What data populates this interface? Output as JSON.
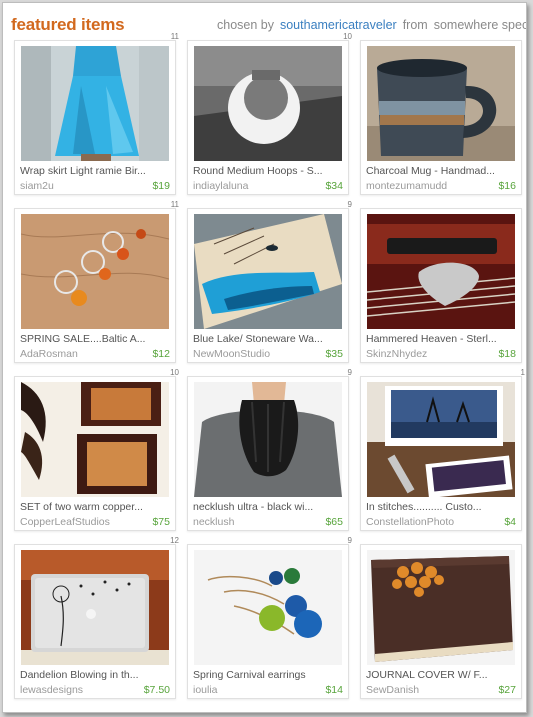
{
  "header": {
    "title": "featured items",
    "chosen_by": "chosen by",
    "curator": "southamericatraveler",
    "from_label": "from",
    "from_text": "somewhere specia"
  },
  "items": [
    {
      "title": "Wrap skirt Light ramie Bir...",
      "shop": "siam2u",
      "price": "$19",
      "count": "11",
      "image": "blue-wrap-skirt"
    },
    {
      "title": "Round Medium Hoops - S...",
      "shop": "indiaylaluna",
      "price": "$34",
      "count": "10",
      "image": "silver-hoop"
    },
    {
      "title": "Charcoal Mug - Handmad...",
      "shop": "montezumamudd",
      "price": "$16",
      "count": "",
      "image": "charcoal-mug"
    },
    {
      "title": "SPRING SALE....Baltic A...",
      "shop": "AdaRosman",
      "price": "$12",
      "count": "11",
      "image": "amber-rings"
    },
    {
      "title": "Blue Lake/ Stoneware Wa...",
      "shop": "NewMoonStudio",
      "price": "$35",
      "count": "9",
      "image": "blue-lake-tile"
    },
    {
      "title": "Hammered Heaven - Sterl...",
      "shop": "SkinzNhydez",
      "price": "$18",
      "count": "",
      "image": "guitar-pick"
    },
    {
      "title": "SET of two warm copper...",
      "shop": "CopperLeafStudios",
      "price": "$75",
      "count": "10",
      "image": "copper-leaf-art"
    },
    {
      "title": "necklush ultra - black wi...",
      "shop": "necklush",
      "price": "$65",
      "count": "9",
      "image": "black-scarf-necklace"
    },
    {
      "title": "In stitches.......... Custo...",
      "shop": "ConstellationPhoto",
      "price": "$4",
      "count": "1",
      "image": "tree-photo-cards"
    },
    {
      "title": "Dandelion Blowing in th...",
      "shop": "lewasdesigns",
      "price": "$7.50",
      "count": "12",
      "image": "dandelion-laptop-decal"
    },
    {
      "title": "Spring Carnival earrings",
      "shop": "ioulia",
      "price": "$14",
      "count": "9",
      "image": "bead-earrings"
    },
    {
      "title": "JOURNAL COVER W/ F...",
      "shop": "SewDanish",
      "price": "$27",
      "count": "",
      "image": "journal-cover"
    }
  ]
}
